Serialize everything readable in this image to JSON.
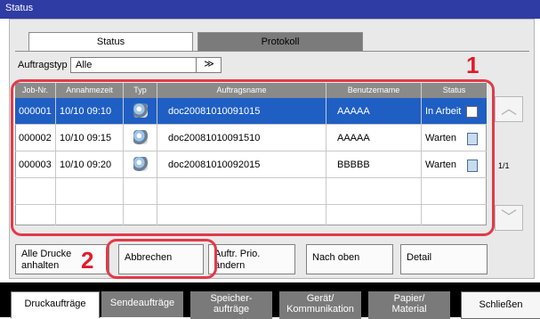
{
  "window": {
    "title": "Status"
  },
  "tabs": {
    "status": "Status",
    "protokoll": "Protokoll"
  },
  "filter": {
    "label": "Auftragstyp",
    "value": "Alle",
    "dropdown_glyph": "≫"
  },
  "table": {
    "headers": [
      "Job-Nr.",
      "Annahmezeit",
      "Typ",
      "Auftragsname",
      "Benutzername",
      "Status"
    ],
    "rows": [
      {
        "job": "000001",
        "time": "10/10 09:10",
        "name": "doc20081010091015",
        "user": "AAAAA",
        "status": "In Arbeit"
      },
      {
        "job": "000002",
        "time": "10/10 09:15",
        "name": "doc20081010091510",
        "user": "AAAAA",
        "status": "Warten"
      },
      {
        "job": "000003",
        "time": "10/10 09:20",
        "name": "doc20081010092015",
        "user": "BBBBB",
        "status": "Warten"
      }
    ]
  },
  "pager": {
    "text": "1/1"
  },
  "buttons": {
    "alle_druck": "Alle Drucke\nanhalten",
    "abbrechen": "Abbrechen",
    "auftr_prio": "Auftr. Prio.\nändern",
    "nach_oben": "Nach oben",
    "detail": "Detail"
  },
  "callouts": {
    "one": "1",
    "two": "2"
  },
  "bottom_tabs": [
    "Druckaufträge",
    "Sendeaufträge",
    "Speicher-\naufträge",
    "Gerät/\nKommunikation",
    "Papier/\nMaterial"
  ],
  "close_button": "Schließen",
  "colors": {
    "title_bar": "#2f3ca3",
    "selected_row": "#1f5fc4",
    "callout_red": "#e21a2c"
  }
}
